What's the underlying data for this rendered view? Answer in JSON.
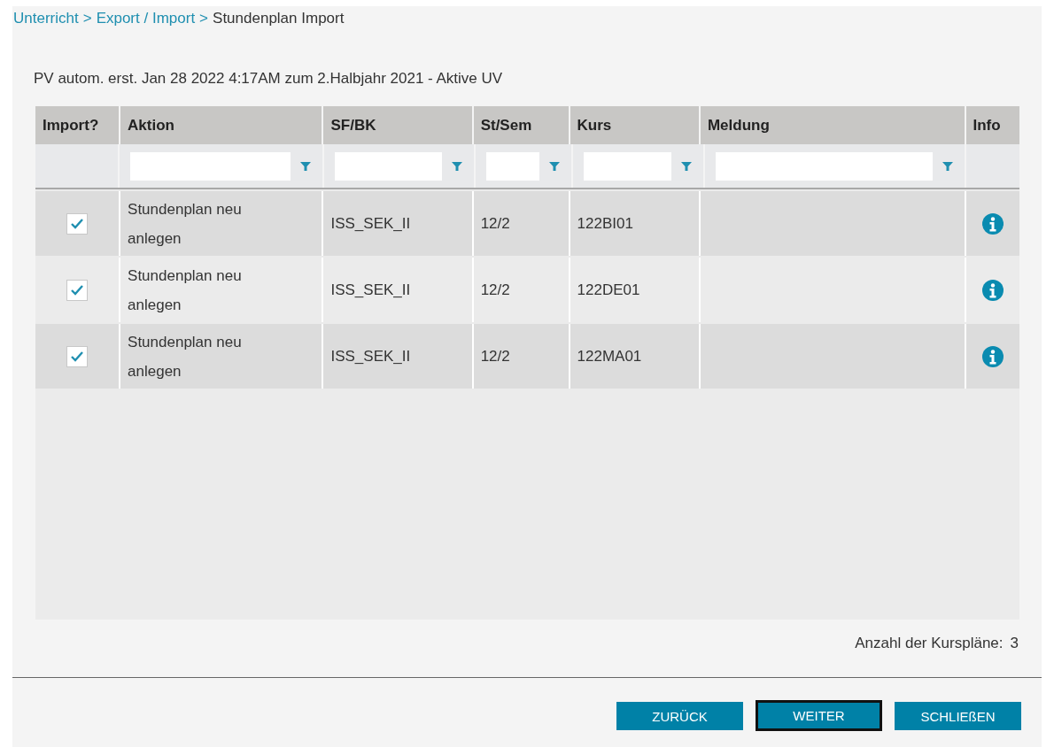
{
  "breadcrumb": [
    {
      "kind": "link",
      "label": "Unterricht"
    },
    {
      "kind": "separator",
      "label": ">"
    },
    {
      "kind": "link",
      "label": "Export / Import"
    },
    {
      "kind": "separator",
      "label": ">"
    },
    {
      "kind": "current",
      "label": "Stundenplan Import"
    }
  ],
  "subtitle": "PV autom. erst. Jan 28 2022 4:17AM zum 2.Halbjahr 2021 - Aktive UV",
  "table": {
    "columns": [
      {
        "label": "Import?",
        "filter": false
      },
      {
        "label": "Aktion",
        "filter": true
      },
      {
        "label": "SF/BK",
        "filter": true
      },
      {
        "label": "St/Sem",
        "filter": true
      },
      {
        "label": "Kurs",
        "filter": true
      },
      {
        "label": "Meldung",
        "filter": true
      },
      {
        "label": "Info",
        "filter": false
      }
    ],
    "rows": [
      {
        "checked": true,
        "aktion": "Stundenplan neu anlegen",
        "sf_bk": "ISS_SEK_II",
        "st_sem": "12/2",
        "kurs": "122BI01"
      },
      {
        "checked": true,
        "aktion": "Stundenplan neu anlegen",
        "sf_bk": "ISS_SEK_II",
        "st_sem": "12/2",
        "kurs": "122DE01"
      },
      {
        "checked": true,
        "aktion": "Stundenplan neu anlegen",
        "sf_bk": "ISS_SEK_II",
        "st_sem": "12/2",
        "kurs": "122MA01"
      }
    ]
  },
  "count": {
    "label": "Anzahl der Kurspläne:",
    "value": "3"
  },
  "buttons": [
    {
      "label": "ZURÜCK",
      "focused": false
    },
    {
      "label": "WEITER",
      "focused": true
    },
    {
      "label": "SCHLIEßEN",
      "focused": false
    }
  ]
}
